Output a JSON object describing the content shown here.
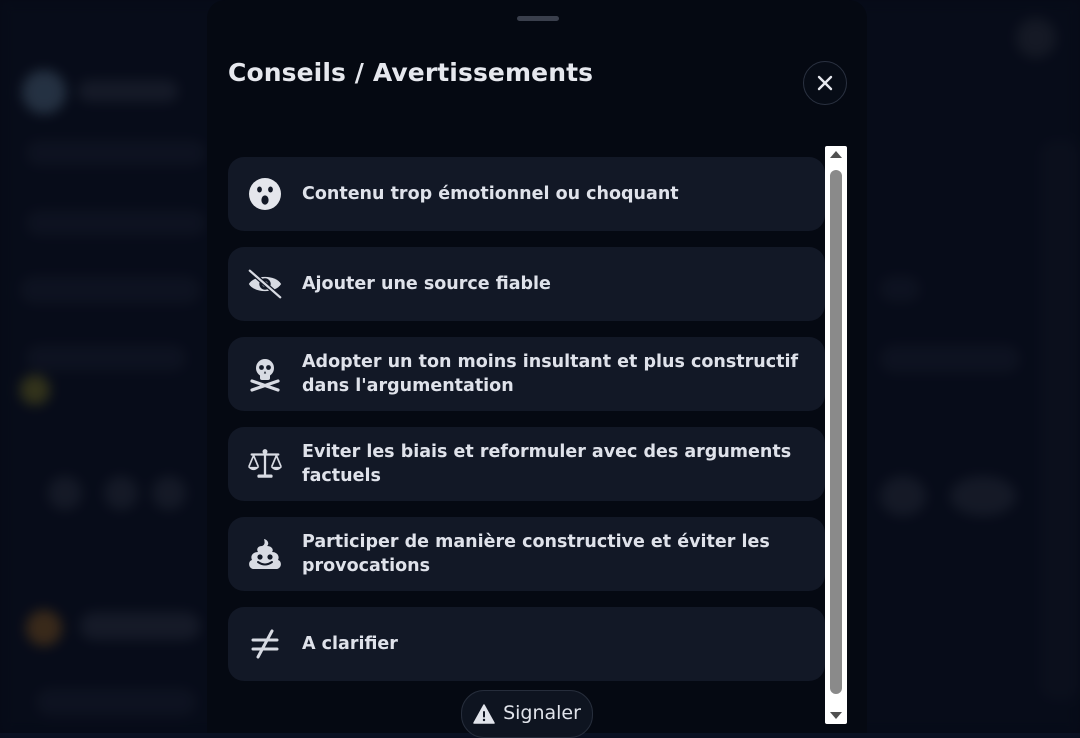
{
  "modal": {
    "title": "Conseils / Avertissements",
    "close_icon": "close-icon"
  },
  "items": [
    {
      "icon": "shocked-face-icon",
      "label": "Contenu trop émotionnel ou choquant"
    },
    {
      "icon": "eye-slash-icon",
      "label": "Ajouter une source fiable"
    },
    {
      "icon": "skull-crossbones-icon",
      "label": "Adopter un ton moins insultant et plus constructif dans l'argumentation"
    },
    {
      "icon": "scale-balance-icon",
      "label": "Eviter les biais et reformuler avec des arguments factuels"
    },
    {
      "icon": "poop-icon",
      "label": "Participer de manière constructive et éviter les provocations"
    },
    {
      "icon": "not-equal-icon",
      "label": "A clarifier"
    }
  ],
  "report": {
    "icon": "warning-icon",
    "label": "Signaler"
  },
  "colors": {
    "sheet_bg": "#050912",
    "item_bg": "#121826",
    "text": "#dfe2ea"
  }
}
